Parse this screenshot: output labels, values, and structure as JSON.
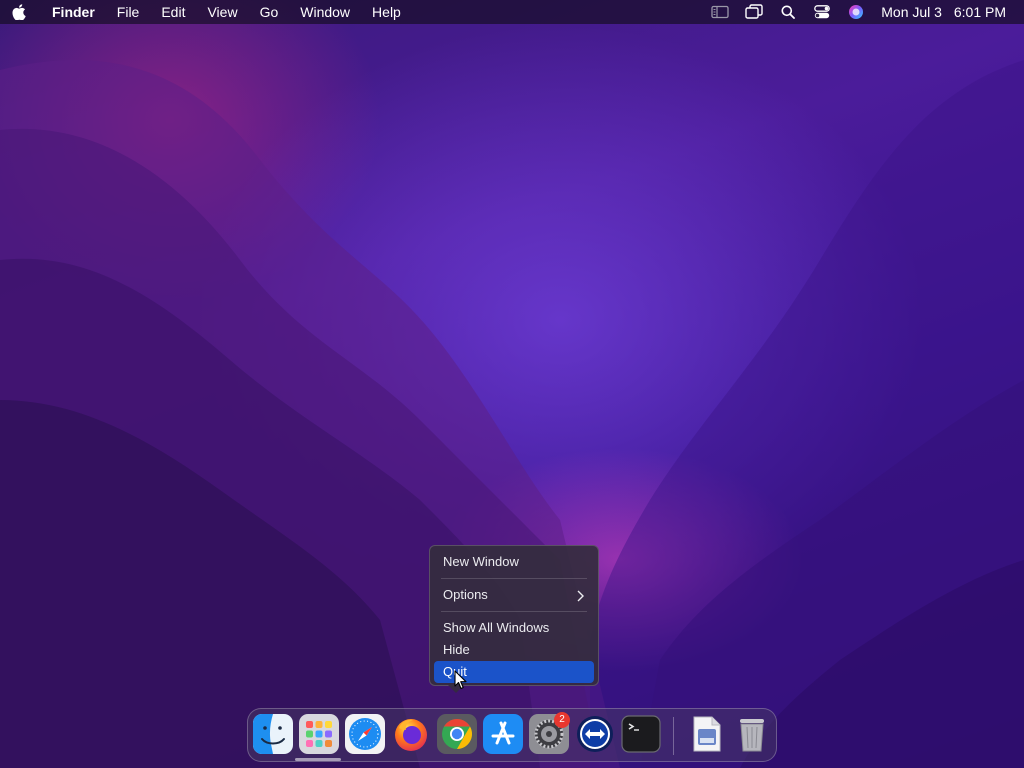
{
  "menubar": {
    "apple_icon": "apple-icon",
    "items": [
      "Finder",
      "File",
      "Edit",
      "View",
      "Go",
      "Window",
      "Help"
    ],
    "status_icons": [
      "sidebar-icon",
      "screen-mirror-icon",
      "search-icon",
      "control-center-icon",
      "siri-icon"
    ],
    "clock": {
      "date": "Mon Jul 3",
      "time": "6:01 PM"
    }
  },
  "context_menu": {
    "items": [
      {
        "label": "New Window"
      },
      {
        "label": "Options",
        "has_submenu": true
      },
      {
        "label": "Show All Windows"
      },
      {
        "label": "Hide"
      },
      {
        "label": "Quit",
        "highlighted": true
      }
    ],
    "highlight_color": "#1b53c9"
  },
  "dock": {
    "apps": [
      {
        "name": "Finder",
        "icon": "finder-icon",
        "running": true
      },
      {
        "name": "Launchpad",
        "icon": "launchpad-icon"
      },
      {
        "name": "Safari",
        "icon": "safari-icon"
      },
      {
        "name": "Firefox",
        "icon": "firefox-icon"
      },
      {
        "name": "Chrome",
        "icon": "chrome-icon"
      },
      {
        "name": "App Store",
        "icon": "app-store-icon"
      },
      {
        "name": "System Settings",
        "icon": "settings-icon",
        "badge": "2"
      },
      {
        "name": "TeamViewer",
        "icon": "teamviewer-icon"
      },
      {
        "name": "Terminal",
        "icon": "terminal-icon"
      }
    ],
    "extras": [
      {
        "name": "Preview",
        "icon": "preview-icon"
      },
      {
        "name": "Trash",
        "icon": "trash-icon"
      }
    ]
  }
}
